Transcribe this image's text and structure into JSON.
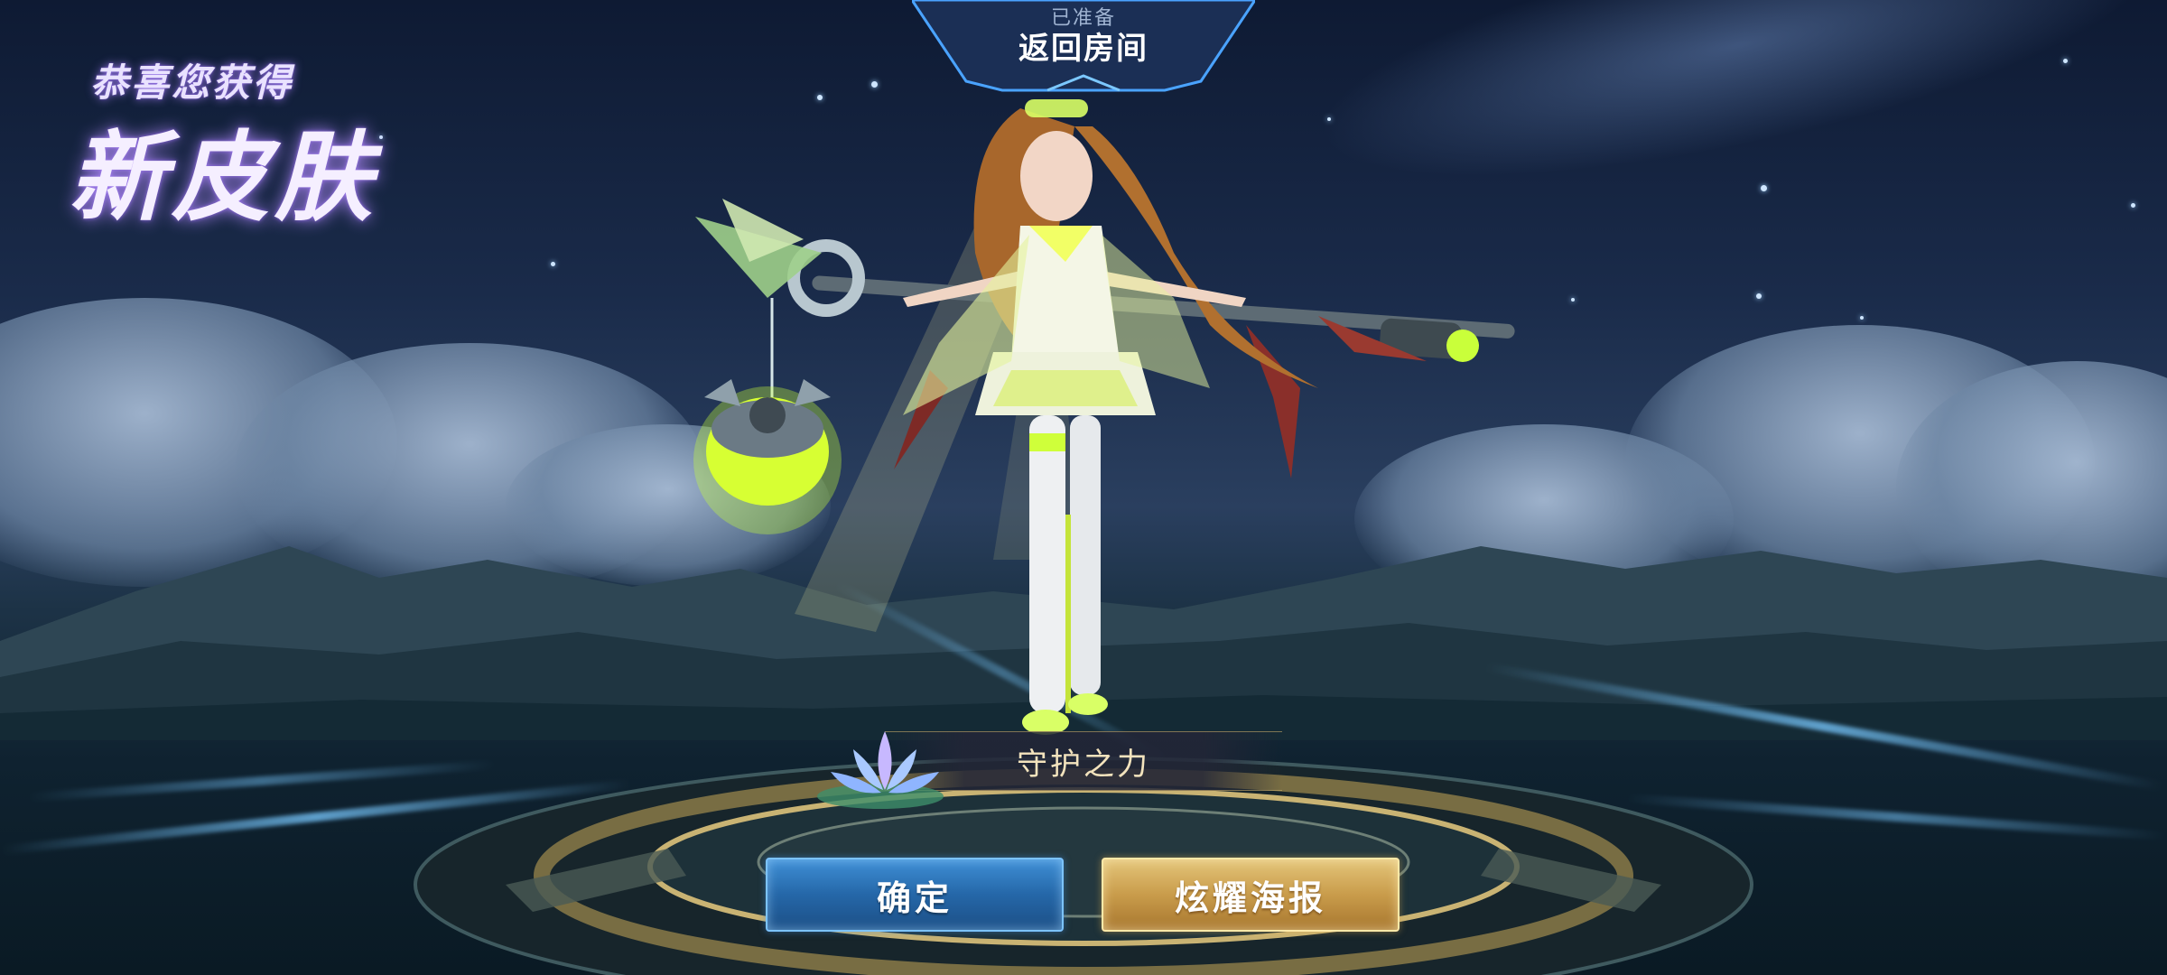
{
  "top_tab": {
    "status": "已准备",
    "label": "返回房间"
  },
  "header": {
    "subtitle": "恭喜您获得",
    "title": "新皮肤"
  },
  "skin": {
    "name": "守护之力"
  },
  "buttons": {
    "confirm_label": "确定",
    "poster_label": "炫耀海报"
  },
  "colors": {
    "confirm_button": "#2567a8",
    "poster_button": "#c99c4b",
    "title_glow": "#b48cff",
    "skin_name_text": "#f3e3bd"
  },
  "icons": {
    "lotus": "lotus-icon"
  }
}
